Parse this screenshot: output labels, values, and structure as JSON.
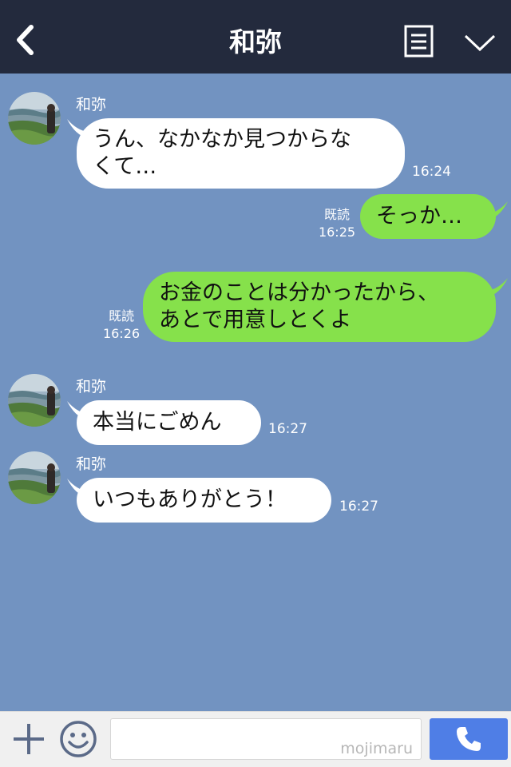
{
  "header": {
    "title": "和弥",
    "back_icon": "chevron-left-icon",
    "menu_icon": "menu-doc-icon",
    "dropdown_icon": "chevron-down-icon"
  },
  "colors": {
    "background": "#7293c1",
    "header": "#232a3d",
    "incoming_bubble": "#ffffff",
    "outgoing_bubble": "#86e14b",
    "call_button": "#4f7ee6"
  },
  "messages": [
    {
      "direction": "incoming",
      "sender": "和弥",
      "text": "うん、なかなか見つからな\nくて…",
      "time": "16:24"
    },
    {
      "direction": "outgoing",
      "read": "既読",
      "text": "そっか…",
      "time": "16:25"
    },
    {
      "direction": "outgoing",
      "read": "既読",
      "text": "お金のことは分かったから、\nあとで用意しとくよ",
      "time": "16:26"
    },
    {
      "direction": "incoming",
      "sender": "和弥",
      "text": "本当にごめん",
      "time": "16:27"
    },
    {
      "direction": "incoming",
      "sender": "和弥",
      "text": "いつもありがとう！",
      "time": "16:27"
    }
  ],
  "input": {
    "placeholder": "",
    "watermark": "mojimaru",
    "plus_icon": "plus-icon",
    "emoji_icon": "smile-icon",
    "call_icon": "phone-icon"
  }
}
